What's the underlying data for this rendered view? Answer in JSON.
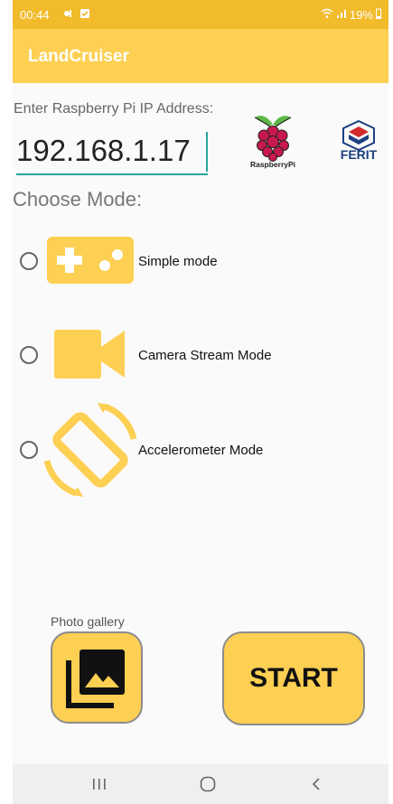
{
  "status_bar": {
    "time": "00:44",
    "battery": "19%"
  },
  "app_bar": {
    "title": "LandCruiser"
  },
  "ip_section": {
    "label": "Enter Raspberry Pi IP Address:",
    "value": "192.168.1.17"
  },
  "logos": {
    "raspberry_text": "RaspberryPi",
    "ferit_text": "FERIT"
  },
  "modes": {
    "title": "Choose Mode:",
    "items": [
      {
        "label": "Simple mode",
        "selected": false,
        "icon": "gamepad-icon"
      },
      {
        "label": "Camera Stream Mode",
        "selected": false,
        "icon": "video-camera-icon"
      },
      {
        "label": "Accelerometer Mode",
        "selected": false,
        "icon": "screen-rotation-icon"
      }
    ]
  },
  "bottom": {
    "gallery_label": "Photo gallery",
    "start_label": "START"
  },
  "colors": {
    "accent": "#fdcf52",
    "status_bar": "#f1bb2c",
    "input_underline": "#26a69a"
  }
}
